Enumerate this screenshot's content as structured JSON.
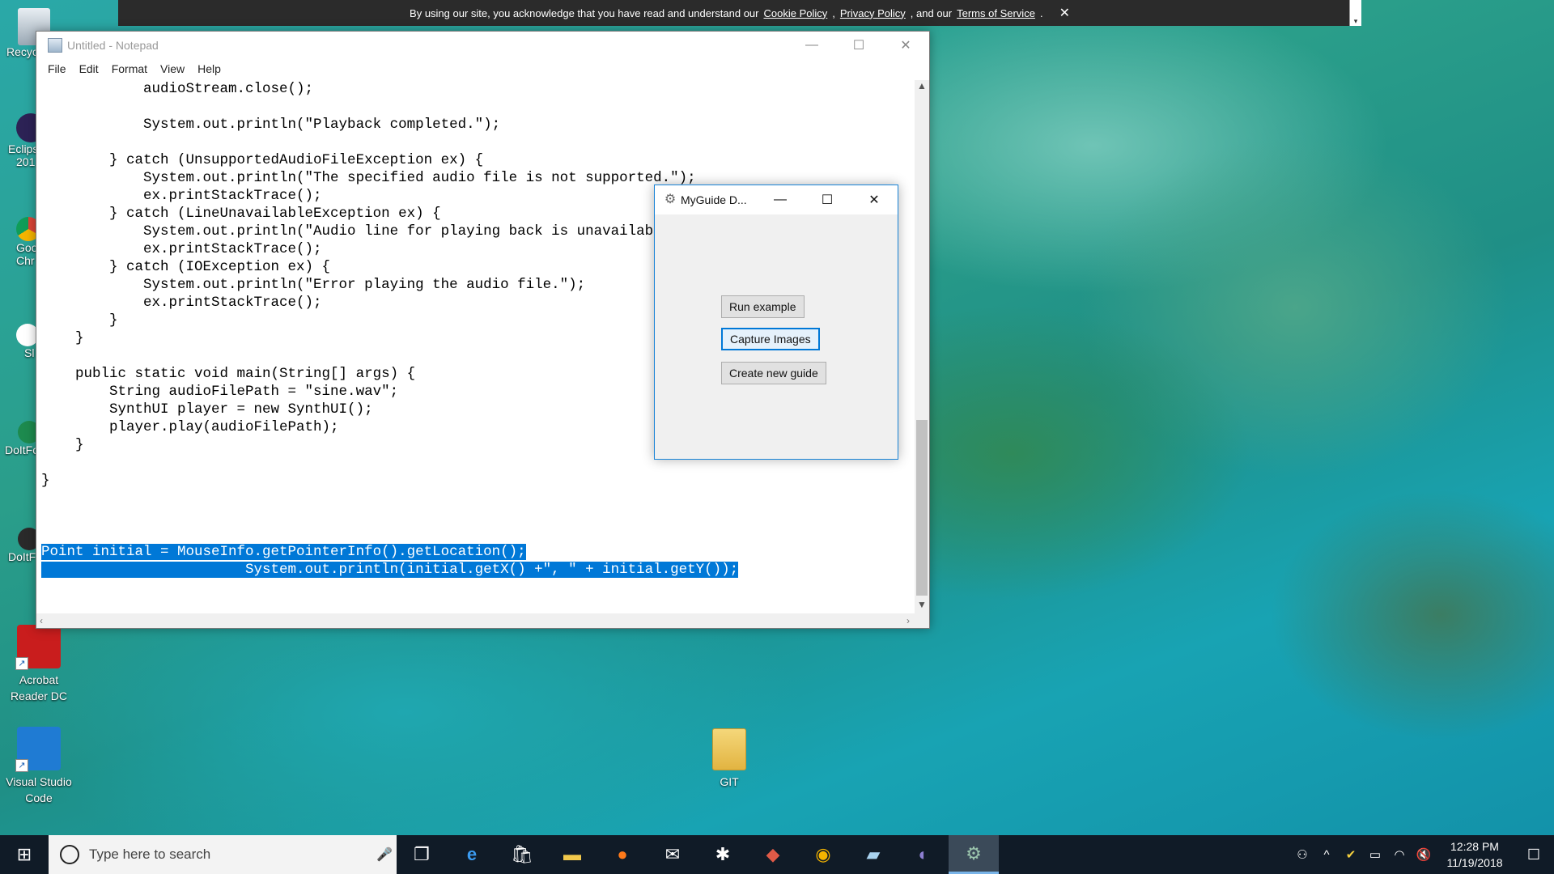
{
  "cookie_banner": {
    "prefix": "By using our site, you acknowledge that you have read and understand our",
    "cookie_policy": "Cookie Policy",
    "comma": ",",
    "privacy_policy": "Privacy Policy",
    "and_our": ", and our",
    "terms": "Terms of Service",
    "period": ".",
    "close": "✕"
  },
  "desktop_icons": {
    "recycle": "Recyc",
    "eclipse": [
      "Eclips",
      "201"
    ],
    "chrome": [
      "Goo",
      "Chr"
    ],
    "slack": "Sl",
    "doit1": "DoItFo",
    "doit2": "DoItF",
    "acrobat": [
      "Acrobat",
      "Reader DC"
    ],
    "vscode": [
      "Visual Studio",
      "Code"
    ],
    "git": "GIT"
  },
  "notepad": {
    "title": "Untitled - Notepad",
    "menu": [
      "File",
      "Edit",
      "Format",
      "View",
      "Help"
    ],
    "code_lines": [
      "            audioStream.close();",
      "",
      "            System.out.println(\"Playback completed.\");",
      "",
      "        } catch (UnsupportedAudioFileException ex) {",
      "            System.out.println(\"The specified audio file is not supported.\");",
      "            ex.printStackTrace();",
      "        } catch (LineUnavailableException ex) {",
      "            System.out.println(\"Audio line for playing back is unavailable.\");",
      "            ex.printStackTrace();",
      "        } catch (IOException ex) {",
      "            System.out.println(\"Error playing the audio file.\");",
      "            ex.printStackTrace();",
      "        }",
      "    }",
      "",
      "    public static void main(String[] args) {",
      "        String audioFilePath = \"sine.wav\";",
      "        SynthUI player = new SynthUI();",
      "        player.play(audioFilePath);",
      "    }",
      "",
      "}",
      "",
      "",
      ""
    ],
    "selected_lines": [
      "Point initial = MouseInfo.getPointerInfo().getLocation();",
      "                        System.out.println(initial.getX() +\", \" + initial.getY());"
    ]
  },
  "myguide": {
    "title": "MyGuide D...",
    "buttons": {
      "run_example": "Run example",
      "capture_images": "Capture Images",
      "create_new_guide": "Create new guide"
    }
  },
  "taskbar": {
    "search_placeholder": "Type here to search",
    "apps": [
      "task-view",
      "edge",
      "store",
      "file-explorer",
      "firefox",
      "mail",
      "slack",
      "git-tool",
      "chrome",
      "notepad-app",
      "eclipse",
      "myguide"
    ],
    "time": "12:28 PM",
    "date": "11/19/2018"
  }
}
